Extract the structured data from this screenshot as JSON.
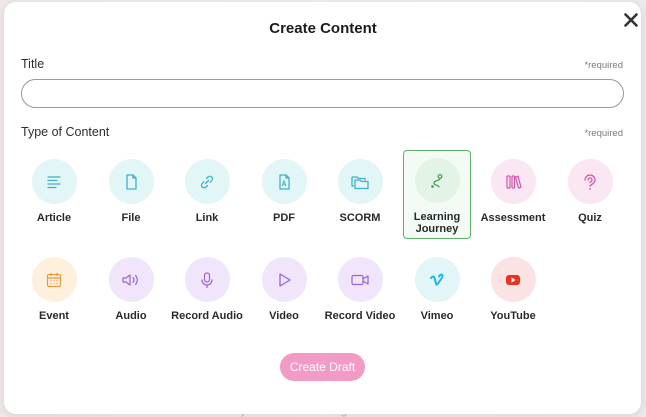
{
  "backdrop": {
    "partial_text": "...n ... your ... the ... learning ... a ... ..."
  },
  "modal": {
    "title": "Create Content",
    "title_field": {
      "label": "Title",
      "required_text": "*required",
      "value": "",
      "placeholder": ""
    },
    "type_field": {
      "label": "Type of Content",
      "required_text": "*required"
    },
    "content_types": [
      {
        "label": "Article",
        "icon": "article-icon",
        "color": "#e2f5f7",
        "selected": false
      },
      {
        "label": "File",
        "icon": "file-icon",
        "color": "#e2f5f7",
        "selected": false
      },
      {
        "label": "Link",
        "icon": "link-icon",
        "color": "#e2f5f7",
        "selected": false
      },
      {
        "label": "PDF",
        "icon": "pdf-icon",
        "color": "#e2f5f7",
        "selected": false
      },
      {
        "label": "SCORM",
        "icon": "folders-icon",
        "color": "#e2f5f7",
        "selected": false
      },
      {
        "label": "Learning Journey",
        "icon": "journey-path-icon",
        "color": "#e3f3e6",
        "selected": true
      },
      {
        "label": "Assessment",
        "icon": "books-icon",
        "color": "#fbe6f3",
        "selected": false
      },
      {
        "label": "Quiz",
        "icon": "question-icon",
        "color": "#fbe6f3",
        "selected": false
      },
      {
        "label": "Event",
        "icon": "calendar-icon",
        "color": "#fdf0dd",
        "selected": false
      },
      {
        "label": "Audio",
        "icon": "speaker-icon",
        "color": "#f0e5fb",
        "selected": false
      },
      {
        "label": "Record Audio",
        "icon": "microphone-icon",
        "color": "#f0e5fb",
        "selected": false
      },
      {
        "label": "Video",
        "icon": "play-icon",
        "color": "#f0e5fb",
        "selected": false
      },
      {
        "label": "Record Video",
        "icon": "video-camera-icon",
        "color": "#f0e5fb",
        "selected": false
      },
      {
        "label": "Vimeo",
        "icon": "vimeo-icon",
        "color": "#e2f5f7",
        "selected": false
      },
      {
        "label": "YouTube",
        "icon": "youtube-icon",
        "color": "#fbe3e3",
        "selected": false
      }
    ],
    "create_button": "Create Draft",
    "close_icon": "close-icon",
    "colors": {
      "selected_border": "#5bb36e",
      "primary_button": "#f29bc6"
    }
  }
}
